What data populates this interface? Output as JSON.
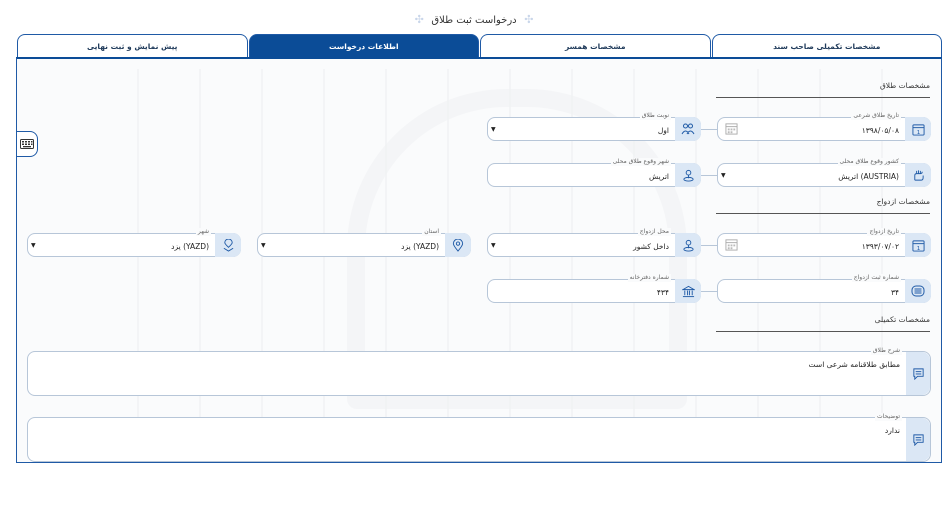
{
  "page_title": "درخواست ثبت طلاق",
  "tabs": [
    {
      "label": "مشخصات تکمیلی صاحب سند",
      "active": false
    },
    {
      "label": "مشخصات همسر",
      "active": false
    },
    {
      "label": "اطلاعات درخواست",
      "active": true
    },
    {
      "label": "پیش نمایش و ثبت نهایی",
      "active": false
    }
  ],
  "sections": {
    "divorce": "مشخصات طلاق",
    "marriage": "مشخصات ازدواج",
    "extra": "مشخصات تکمیلی"
  },
  "fields": {
    "divorce_date": {
      "label": "تاریخ طلاق شرعی",
      "value": "۱۳۹۸/۰۵/۰۸"
    },
    "divorce_turn": {
      "label": "نوبت طلاق",
      "value": "اول"
    },
    "divorce_country": {
      "label": "کشور وقوع طلاق محلی",
      "value": "اتریش (AUSTRIA)"
    },
    "divorce_city": {
      "label": "شهر وقوع طلاق محلی",
      "value": "اتریش"
    },
    "marriage_date": {
      "label": "تاریخ ازدواج",
      "value": "۱۳۹۳/۰۷/۰۲"
    },
    "marriage_place": {
      "label": "محل ازدواج",
      "value": "داخل کشور"
    },
    "province": {
      "label": "استان",
      "value": "یزد (YAZD)"
    },
    "city": {
      "label": "شهر",
      "value": "یزد (YAZD)"
    },
    "marriage_reg_no": {
      "label": "شماره ثبت ازدواج",
      "value": "۳۴"
    },
    "office_no": {
      "label": "شماره دفترخانه",
      "value": "۴۳۴"
    },
    "divorce_desc": {
      "label": "شرح طلاق",
      "value": "مطابق طلاقنامه شرعی است"
    },
    "notes": {
      "label": "توضیحات",
      "value": "ندارد"
    }
  },
  "colors": {
    "primary": "#0b4c97",
    "border": "#1f5aa6",
    "icon_bg": "#dbe7f5"
  },
  "icons": [
    "calendar-icon",
    "couple-icon",
    "map-hand-icon",
    "location-pin-icon",
    "map-marker-icon",
    "person-pin-icon",
    "id-card-icon",
    "bank-building-icon",
    "message-icon",
    "keyboard-icon"
  ]
}
